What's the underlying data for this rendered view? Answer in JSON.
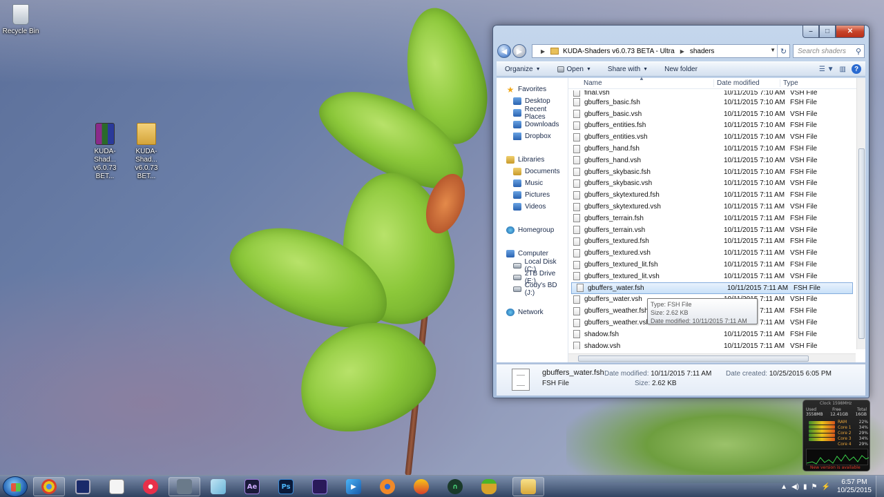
{
  "desktop": {
    "icons": [
      {
        "label": "Recycle Bin"
      },
      {
        "label": "KUDA-Shad... v6.0.73 BET..."
      },
      {
        "label": "KUDA-Shad... v6.0.73 BET..."
      }
    ]
  },
  "explorer": {
    "breadcrumb": [
      "KUDA-Shaders v6.0.73 BETA - Ultra",
      "shaders"
    ],
    "search_placeholder": "Search shaders",
    "toolbar": {
      "organize": "Organize",
      "open": "Open",
      "share_with": "Share with",
      "new_folder": "New folder"
    },
    "nav": {
      "favorites": "Favorites",
      "favorites_items": [
        "Desktop",
        "Recent Places",
        "Downloads",
        "Dropbox"
      ],
      "libraries": "Libraries",
      "libraries_items": [
        "Documents",
        "Music",
        "Pictures",
        "Videos"
      ],
      "homegroup": "Homegroup",
      "computer": "Computer",
      "computer_items": [
        "Local Disk (C:)",
        "2TB Drive (E:)",
        "Cody's BD (J:)"
      ],
      "network": "Network"
    },
    "columns": {
      "name": "Name",
      "date": "Date modified",
      "type": "Type"
    },
    "partial_row": {
      "name": "final.vsh",
      "date": "10/11/2015 7:10 AM",
      "type": "VSH File"
    },
    "files": [
      {
        "name": "gbuffers_basic.fsh",
        "date": "10/11/2015 7:10 AM",
        "type": "FSH File"
      },
      {
        "name": "gbuffers_basic.vsh",
        "date": "10/11/2015 7:10 AM",
        "type": "VSH File"
      },
      {
        "name": "gbuffers_entities.fsh",
        "date": "10/11/2015 7:10 AM",
        "type": "FSH File"
      },
      {
        "name": "gbuffers_entities.vsh",
        "date": "10/11/2015 7:10 AM",
        "type": "VSH File"
      },
      {
        "name": "gbuffers_hand.fsh",
        "date": "10/11/2015 7:10 AM",
        "type": "FSH File"
      },
      {
        "name": "gbuffers_hand.vsh",
        "date": "10/11/2015 7:10 AM",
        "type": "VSH File"
      },
      {
        "name": "gbuffers_skybasic.fsh",
        "date": "10/11/2015 7:10 AM",
        "type": "FSH File"
      },
      {
        "name": "gbuffers_skybasic.vsh",
        "date": "10/11/2015 7:10 AM",
        "type": "VSH File"
      },
      {
        "name": "gbuffers_skytextured.fsh",
        "date": "10/11/2015 7:11 AM",
        "type": "FSH File"
      },
      {
        "name": "gbuffers_skytextured.vsh",
        "date": "10/11/2015 7:11 AM",
        "type": "VSH File"
      },
      {
        "name": "gbuffers_terrain.fsh",
        "date": "10/11/2015 7:11 AM",
        "type": "FSH File"
      },
      {
        "name": "gbuffers_terrain.vsh",
        "date": "10/11/2015 7:11 AM",
        "type": "VSH File"
      },
      {
        "name": "gbuffers_textured.fsh",
        "date": "10/11/2015 7:11 AM",
        "type": "FSH File"
      },
      {
        "name": "gbuffers_textured.vsh",
        "date": "10/11/2015 7:11 AM",
        "type": "VSH File"
      },
      {
        "name": "gbuffers_textured_lit.fsh",
        "date": "10/11/2015 7:11 AM",
        "type": "FSH File"
      },
      {
        "name": "gbuffers_textured_lit.vsh",
        "date": "10/11/2015 7:11 AM",
        "type": "VSH File"
      },
      {
        "name": "gbuffers_water.fsh",
        "date": "10/11/2015 7:11 AM",
        "type": "FSH File",
        "selected": true
      },
      {
        "name": "gbuffers_water.vsh",
        "date": "10/11/2015 7:11 AM",
        "type": "VSH File"
      },
      {
        "name": "gbuffers_weather.fsh",
        "date": "10/11/2015 7:11 AM",
        "type": "FSH File"
      },
      {
        "name": "gbuffers_weather.vsh",
        "date": "10/11/2015 7:11 AM",
        "type": "VSH File"
      },
      {
        "name": "shadow.fsh",
        "date": "10/11/2015 7:11 AM",
        "type": "FSH File"
      },
      {
        "name": "shadow.vsh",
        "date": "10/11/2015 7:11 AM",
        "type": "VSH File"
      }
    ],
    "tooltip": {
      "type": "Type: FSH File",
      "size": "Size: 2.62 KB",
      "date": "Date modified: 10/11/2015 7:11 AM"
    },
    "details": {
      "name": "gbuffers_water.fsh",
      "type": "FSH File",
      "date_modified_label": "Date modified:",
      "date_modified": "10/11/2015 7:11 AM",
      "size_label": "Size:",
      "size": "2.62 KB",
      "date_created_label": "Date created:",
      "date_created": "10/25/2015 6:05 PM"
    }
  },
  "gadget": {
    "title": "Clock 1598MHz",
    "headers": [
      "Used",
      "Free",
      "Total"
    ],
    "values": [
      "3558MB",
      "12.41GB",
      "16GB"
    ],
    "rows": [
      {
        "label": "RAM",
        "value": "22%"
      },
      {
        "label": "Core 1",
        "value": "34%"
      },
      {
        "label": "Core 2",
        "value": "29%"
      },
      {
        "label": "Core 3",
        "value": "34%"
      },
      {
        "label": "Core 4",
        "value": "29%"
      }
    ],
    "warning": "New version is available"
  },
  "taskbar": {
    "clock_time": "6:57 PM",
    "clock_date": "10/25/2015",
    "apps": [
      "Chrome",
      "Monitor",
      "Notepad",
      "iTunes",
      "Explorer",
      "App",
      "After Effects",
      "Photoshop",
      "Premiere",
      "Media Player",
      "Blender",
      "Audio",
      "Headphones",
      "Pineapple",
      "Windows Explorer"
    ],
    "ae_label": "Ae",
    "ps_label": "Ps"
  }
}
